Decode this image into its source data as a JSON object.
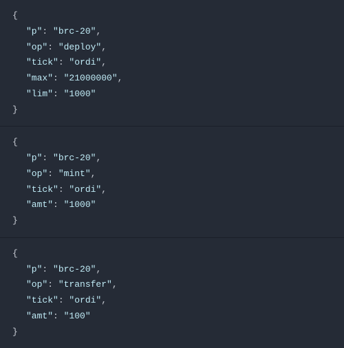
{
  "blocks": [
    {
      "entries": [
        {
          "key": "\"p\"",
          "value": "\"brc-20\"",
          "comma": true
        },
        {
          "key": "\"op\"",
          "value": "\"deploy\"",
          "comma": true
        },
        {
          "key": "\"tick\"",
          "value": "\"ordi\"",
          "comma": true
        },
        {
          "key": "\"max\"",
          "value": "\"21000000\"",
          "comma": true
        },
        {
          "key": "\"lim\"",
          "value": "\"1000\"",
          "comma": false
        }
      ]
    },
    {
      "entries": [
        {
          "key": "\"p\"",
          "value": "\"brc-20\"",
          "comma": true
        },
        {
          "key": "\"op\"",
          "value": "\"mint\"",
          "comma": true
        },
        {
          "key": "\"tick\"",
          "value": "\"ordi\"",
          "comma": true
        },
        {
          "key": "\"amt\"",
          "value": "\"1000\"",
          "comma": false
        }
      ]
    },
    {
      "entries": [
        {
          "key": "\"p\"",
          "value": "\"brc-20\"",
          "comma": true
        },
        {
          "key": "\"op\"",
          "value": "\"transfer\"",
          "comma": true
        },
        {
          "key": "\"tick\"",
          "value": "\"ordi\"",
          "comma": true
        },
        {
          "key": "\"amt\"",
          "value": "\"100\"",
          "comma": false
        }
      ]
    }
  ],
  "braces": {
    "open": "{",
    "close": "}"
  },
  "sep": {
    "colon": ": ",
    "comma": ","
  }
}
